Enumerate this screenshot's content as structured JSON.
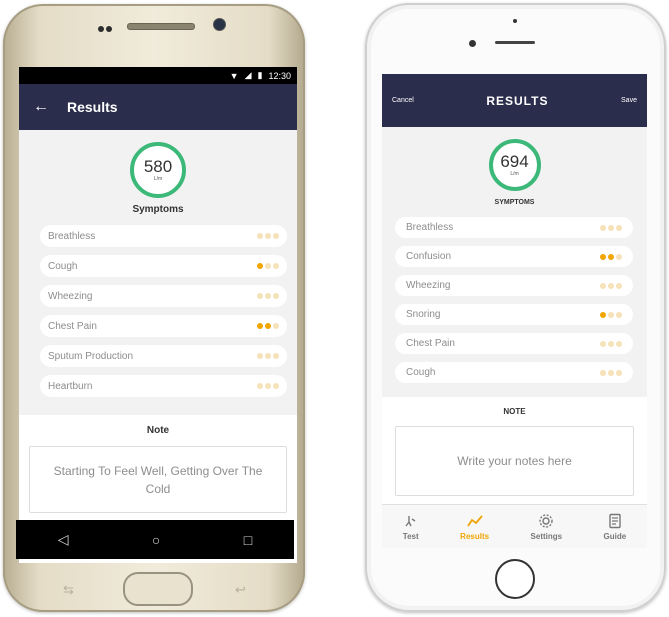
{
  "android": {
    "status": {
      "time": "12:30"
    },
    "appbar": {
      "back_icon": "arrow-left-icon",
      "title": "Results"
    },
    "gauge": {
      "value": "580",
      "unit": "L/m",
      "color": "#3cb878"
    },
    "section_title": "Symptoms",
    "symptoms": [
      {
        "label": "Breathless",
        "level": 0
      },
      {
        "label": "Cough",
        "level": 1
      },
      {
        "label": "Wheezing",
        "level": 0
      },
      {
        "label": "Chest Pain",
        "level": 2
      },
      {
        "label": "Sputum Production",
        "level": 0
      },
      {
        "label": "Heartburn",
        "level": 0
      }
    ],
    "note": {
      "label": "Note",
      "text": "Starting To Feel Well, Getting Over The Cold"
    },
    "nav": {
      "back": "◁",
      "home": "○",
      "recents": "□"
    },
    "soft_left": "⇆",
    "soft_right": "↩"
  },
  "iphone": {
    "appbar": {
      "cancel": "Cancel",
      "title": "RESULTS",
      "save": "Save"
    },
    "gauge": {
      "value": "694",
      "unit": "L/m",
      "color": "#3cb878"
    },
    "section_title": "SYMPTOMS",
    "symptoms": [
      {
        "label": "Breathless",
        "level": 0
      },
      {
        "label": "Confusion",
        "level": 2
      },
      {
        "label": "Wheezing",
        "level": 0
      },
      {
        "label": "Snoring",
        "level": 1
      },
      {
        "label": "Chest Pain",
        "level": 0
      },
      {
        "label": "Cough",
        "level": 0
      }
    ],
    "note": {
      "label": "NOTE",
      "placeholder": "Write your notes here"
    },
    "tabs": [
      {
        "label": "Test",
        "icon": "lungs-icon",
        "active": false
      },
      {
        "label": "Results",
        "icon": "trend-line-icon",
        "active": true
      },
      {
        "label": "Settings",
        "icon": "gear-icon",
        "active": false
      },
      {
        "label": "Guide",
        "icon": "document-icon",
        "active": false
      }
    ]
  },
  "colors": {
    "appbar": "#2b2d4c",
    "accent": "#f0a500",
    "dot_off": "#f6e2b8"
  }
}
